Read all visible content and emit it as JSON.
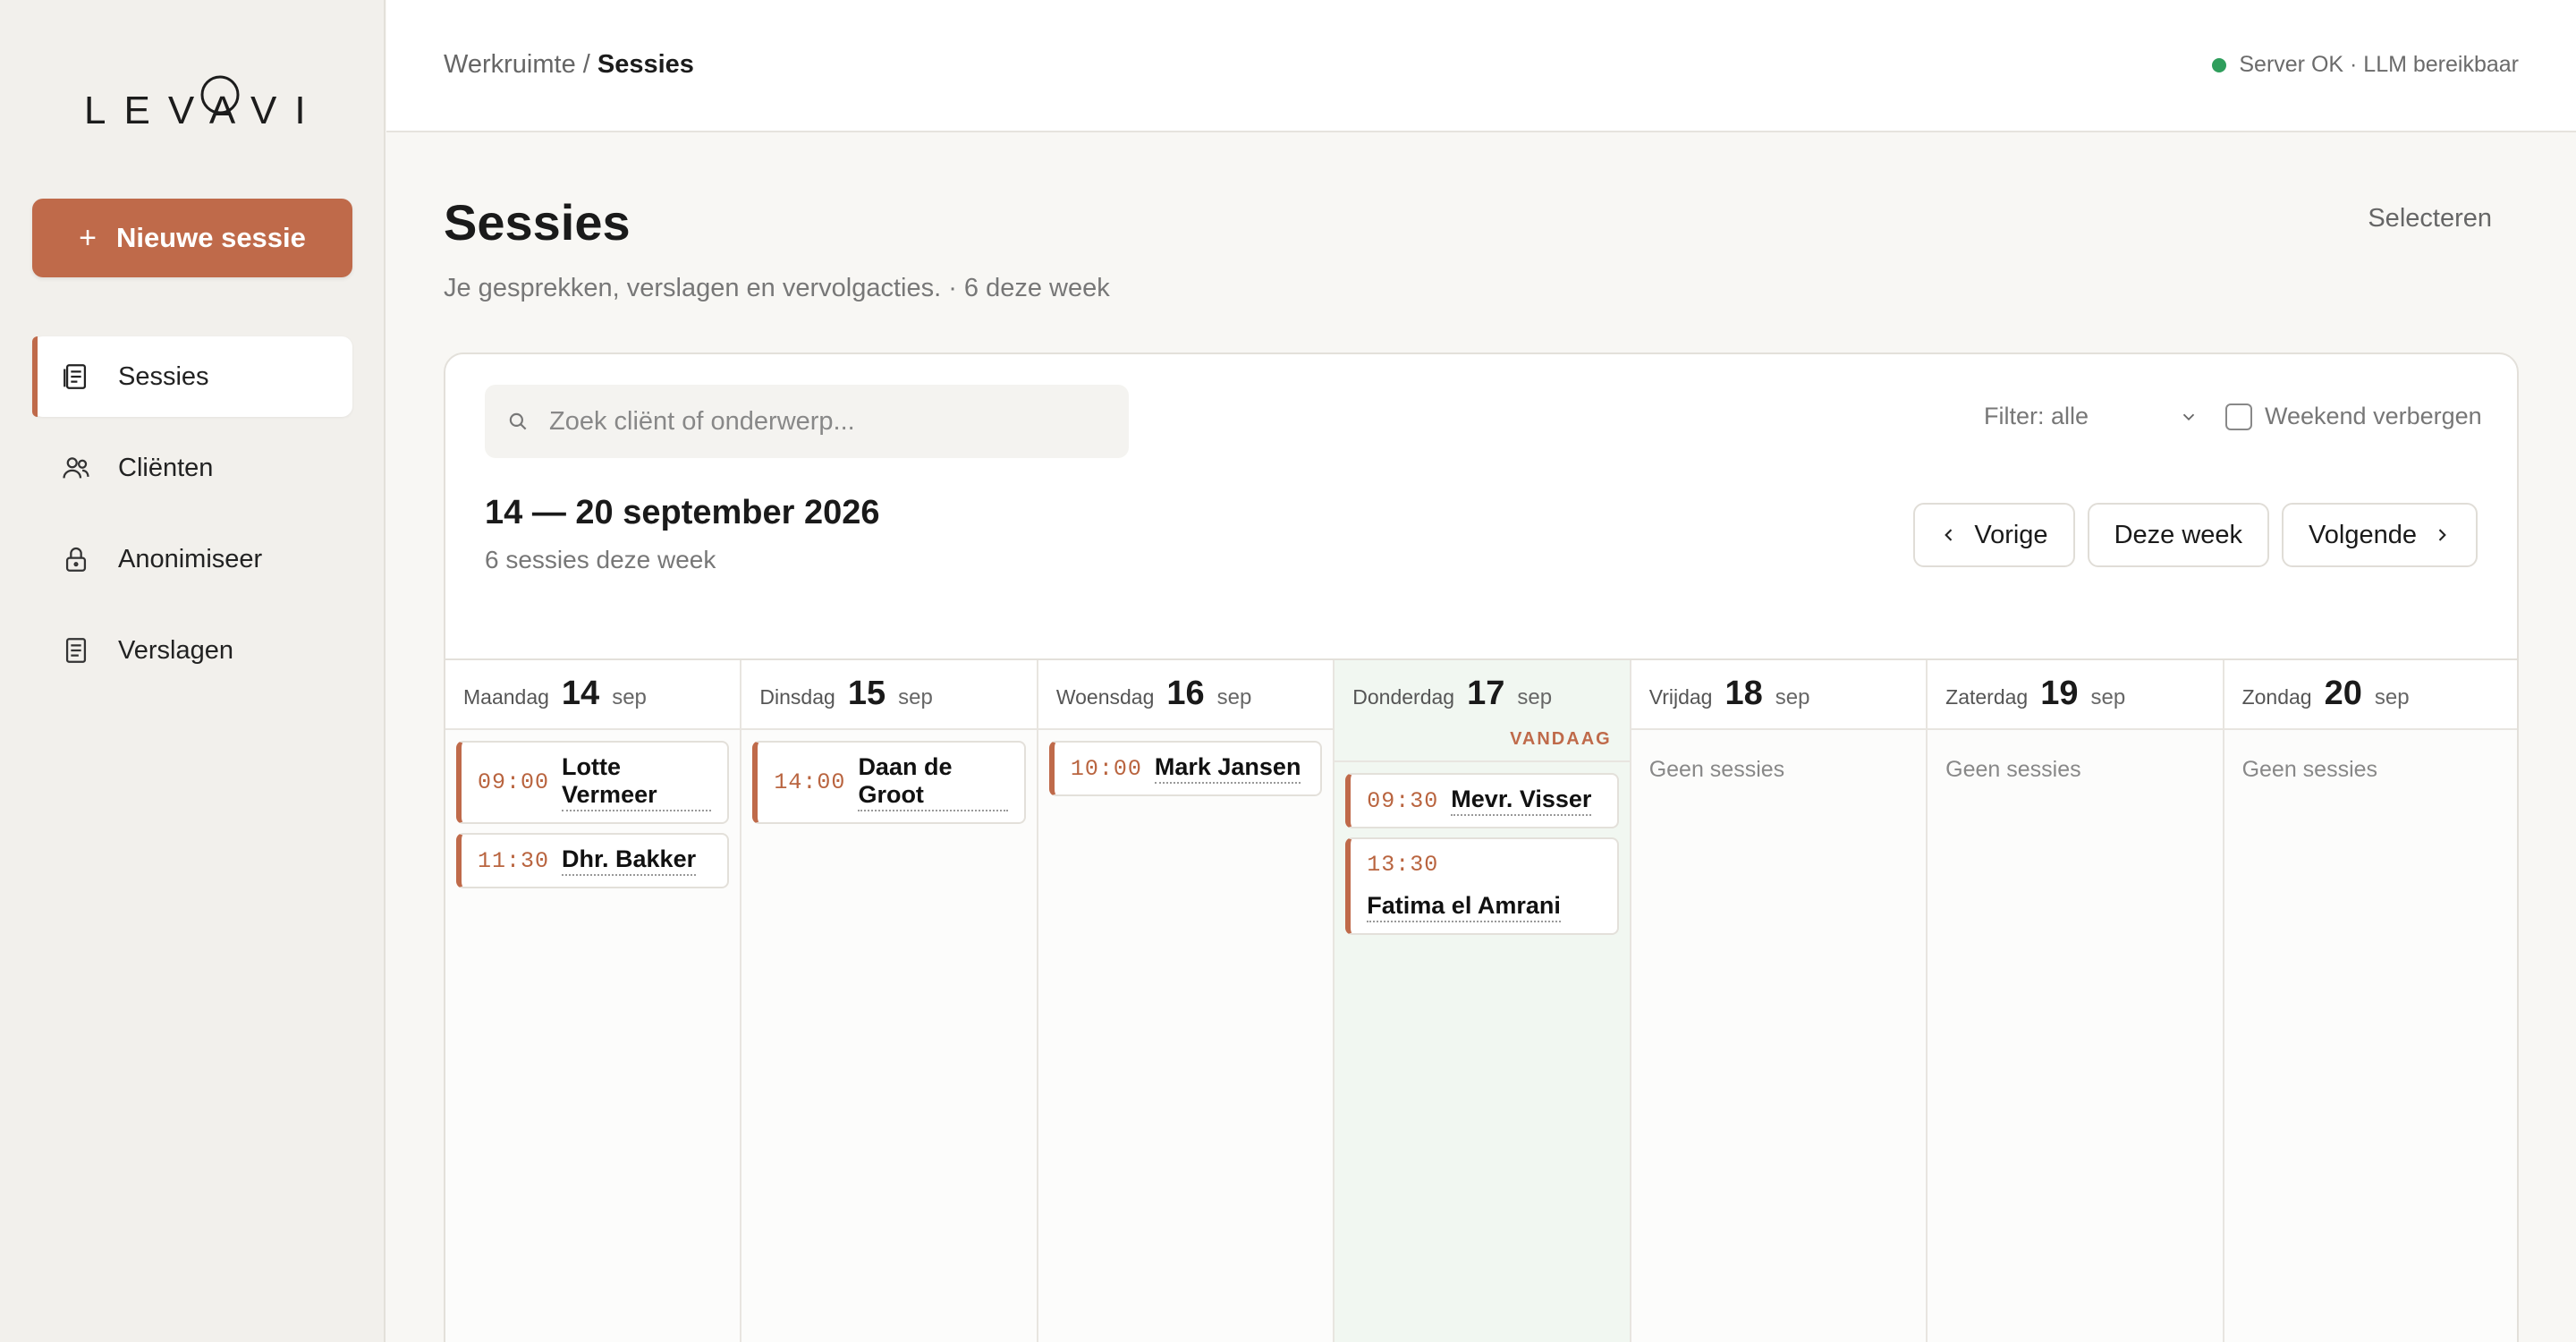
{
  "app": {
    "brand": "LEVAVI",
    "accent_color": "#bf6a4a"
  },
  "sidebar": {
    "new_session_label": "Nieuwe sessie",
    "items": [
      {
        "label": "Sessies",
        "icon": "document-icon",
        "active": true
      },
      {
        "label": "Cliënten",
        "icon": "users-icon",
        "active": false
      },
      {
        "label": "Anonimiseer",
        "icon": "lock-icon",
        "active": false
      },
      {
        "label": "Verslagen",
        "icon": "report-icon",
        "active": false
      }
    ]
  },
  "topbar": {
    "breadcrumb_root": "Werkruimte /",
    "breadcrumb_current": "Sessies",
    "status_text": "Server OK · LLM bereikbaar",
    "status_color": "#2f9e5c"
  },
  "page": {
    "title": "Sessies",
    "subtitle": "Je gesprekken, verslagen en vervolgacties. · 6 deze week",
    "select_label": "Selecteren"
  },
  "toolbar": {
    "search_placeholder": "Zoek cliënt of onderwerp...",
    "filter_label": "Filter: alle",
    "weekend_label": "Weekend verbergen",
    "weekend_checked": false
  },
  "week": {
    "range_title": "14 — 20 september 2026",
    "range_sub": "6 sessies deze week",
    "prev_label": "Vorige",
    "this_week_label": "Deze week",
    "next_label": "Volgende"
  },
  "calendar": {
    "today_badge": "VANDAAG",
    "empty_label": "Geen sessies",
    "days": [
      {
        "name": "Maandag",
        "num": "14",
        "month": "sep",
        "today": false,
        "events": [
          {
            "time": "09:00",
            "client": "Lotte Vermeer"
          },
          {
            "time": "11:30",
            "client": "Dhr. Bakker"
          }
        ]
      },
      {
        "name": "Dinsdag",
        "num": "15",
        "month": "sep",
        "today": false,
        "events": [
          {
            "time": "14:00",
            "client": "Daan de Groot"
          }
        ]
      },
      {
        "name": "Woensdag",
        "num": "16",
        "month": "sep",
        "today": false,
        "events": [
          {
            "time": "10:00",
            "client": "Mark Jansen"
          }
        ]
      },
      {
        "name": "Donderdag",
        "num": "17",
        "month": "sep",
        "today": true,
        "events": [
          {
            "time": "09:30",
            "client": "Mevr. Visser"
          },
          {
            "time": "13:30",
            "client": "Fatima el Amrani"
          }
        ]
      },
      {
        "name": "Vrijdag",
        "num": "18",
        "month": "sep",
        "today": false,
        "events": []
      },
      {
        "name": "Zaterdag",
        "num": "19",
        "month": "sep",
        "today": false,
        "events": []
      },
      {
        "name": "Zondag",
        "num": "20",
        "month": "sep",
        "today": false,
        "events": []
      }
    ]
  }
}
